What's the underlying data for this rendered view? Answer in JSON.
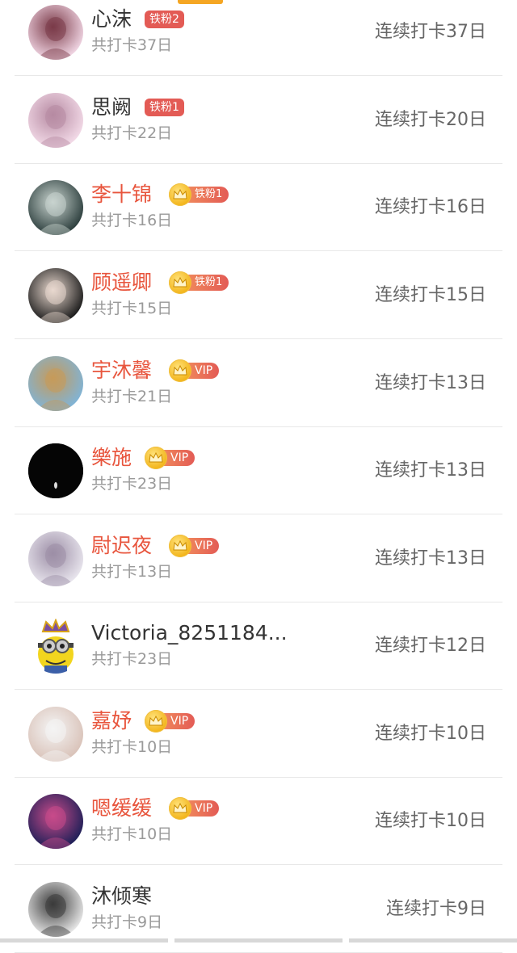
{
  "rows": [
    {
      "name": "心沫",
      "name_color": "plain",
      "badge": {
        "type": "tie",
        "label": "铁粉2"
      },
      "sub": "共打卡37日",
      "streak": "连续打卡37日",
      "avatar": "portrait-girl-icon",
      "colors": [
        "#f1d6e4",
        "#7a3a48"
      ]
    },
    {
      "name": "思阙",
      "name_color": "plain",
      "badge": {
        "type": "tie",
        "label": "铁粉1"
      },
      "sub": "共打卡22日",
      "streak": "连续打卡20日",
      "avatar": "portrait-girl-icon",
      "colors": [
        "#f3dbe8",
        "#b68aa2"
      ]
    },
    {
      "name": "李十锦",
      "name_color": "vip",
      "badge": {
        "type": "crown",
        "label": "铁粉1"
      },
      "sub": "共打卡16日",
      "streak": "连续打卡16日",
      "avatar": "portrait-girl-icon",
      "colors": [
        "#2b3d3c",
        "#c9d4cf"
      ]
    },
    {
      "name": "顾遥卿",
      "name_color": "vip",
      "badge": {
        "type": "crown",
        "label": "铁粉1"
      },
      "sub": "共打卡15日",
      "streak": "连续打卡15日",
      "avatar": "portrait-girl-icon",
      "colors": [
        "#1a1a1a",
        "#e9d9cf"
      ]
    },
    {
      "name": "宇沐馨",
      "name_color": "vip",
      "badge": {
        "type": "crown",
        "label": "VIP"
      },
      "sub": "共打卡21日",
      "streak": "连续打卡13日",
      "avatar": "landscape-person-icon",
      "colors": [
        "#7fb4d8",
        "#c69a5a"
      ]
    },
    {
      "name": "樂施",
      "name_color": "vip",
      "badge": {
        "type": "crown",
        "label": "VIP"
      },
      "sub": "共打卡23日",
      "streak": "连续打卡13日",
      "avatar": "dark-icon",
      "colors": [
        "#050505",
        "#222222"
      ]
    },
    {
      "name": "尉迟夜",
      "name_color": "vip",
      "badge": {
        "type": "crown",
        "label": "VIP"
      },
      "sub": "共打卡13日",
      "streak": "连续打卡13日",
      "avatar": "portrait-girl-icon",
      "colors": [
        "#e9e6ee",
        "#9c8ea6"
      ]
    },
    {
      "name": "Victoria_8251184...",
      "name_color": "plain",
      "badge": null,
      "sub": "共打卡23日",
      "streak": "连续打卡12日",
      "avatar": "minion-crown-icon",
      "colors": [
        "#f2d51e",
        "#7a4fa0"
      ]
    },
    {
      "name": "嘉妤",
      "name_color": "vip",
      "badge": {
        "type": "crown",
        "label": "VIP"
      },
      "sub": "共打卡10日",
      "streak": "连续打卡10日",
      "avatar": "masked-face-icon",
      "colors": [
        "#d9c2b8",
        "#f4f4f4"
      ]
    },
    {
      "name": "嗯缓缓",
      "name_color": "vip",
      "badge": {
        "type": "crown",
        "label": "VIP"
      },
      "sub": "共打卡10日",
      "streak": "连续打卡10日",
      "avatar": "stage-group-icon",
      "colors": [
        "#1d1f57",
        "#c84b8a"
      ]
    },
    {
      "name": "沐倾寒",
      "name_color": "plain",
      "badge": null,
      "sub": "共打卡9日",
      "streak": "连续打卡9日",
      "avatar": "portrait-girl-icon",
      "colors": [
        "#e8e8e8",
        "#3a3a3a"
      ]
    }
  ]
}
